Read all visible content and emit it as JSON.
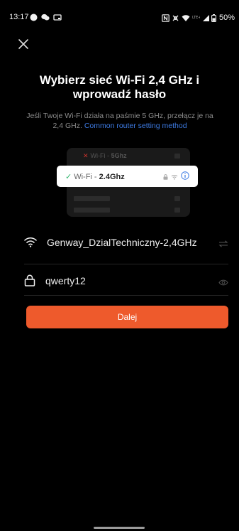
{
  "status_bar": {
    "time": "13:17",
    "battery": "50%"
  },
  "header": {
    "title_line1": "Wybierz sieć Wi-Fi 2,4 GHz i",
    "title_line2": "wprowadź hasło",
    "subtitle_line1": "Jeśli Twoje Wi-Fi działa na paśmie 5 GHz, przełącz je na",
    "subtitle_line2_prefix": "2,4 GHz.",
    "subtitle_link": "Common router setting method"
  },
  "illustration": {
    "bad_network_prefix": "Wi-Fi -",
    "bad_network_band": "5Ghz",
    "good_network_prefix": "Wi-Fi -",
    "good_network_band": "2.4Ghz"
  },
  "form": {
    "wifi_name": "Genway_DzialTechniczny-2,4GHz",
    "password": "qwerty12"
  },
  "actions": {
    "next_label": "Dalej"
  },
  "colors": {
    "accent": "#ee5a2c",
    "link": "#3d7be3",
    "check": "#2db56b",
    "cross": "#c9332d"
  }
}
